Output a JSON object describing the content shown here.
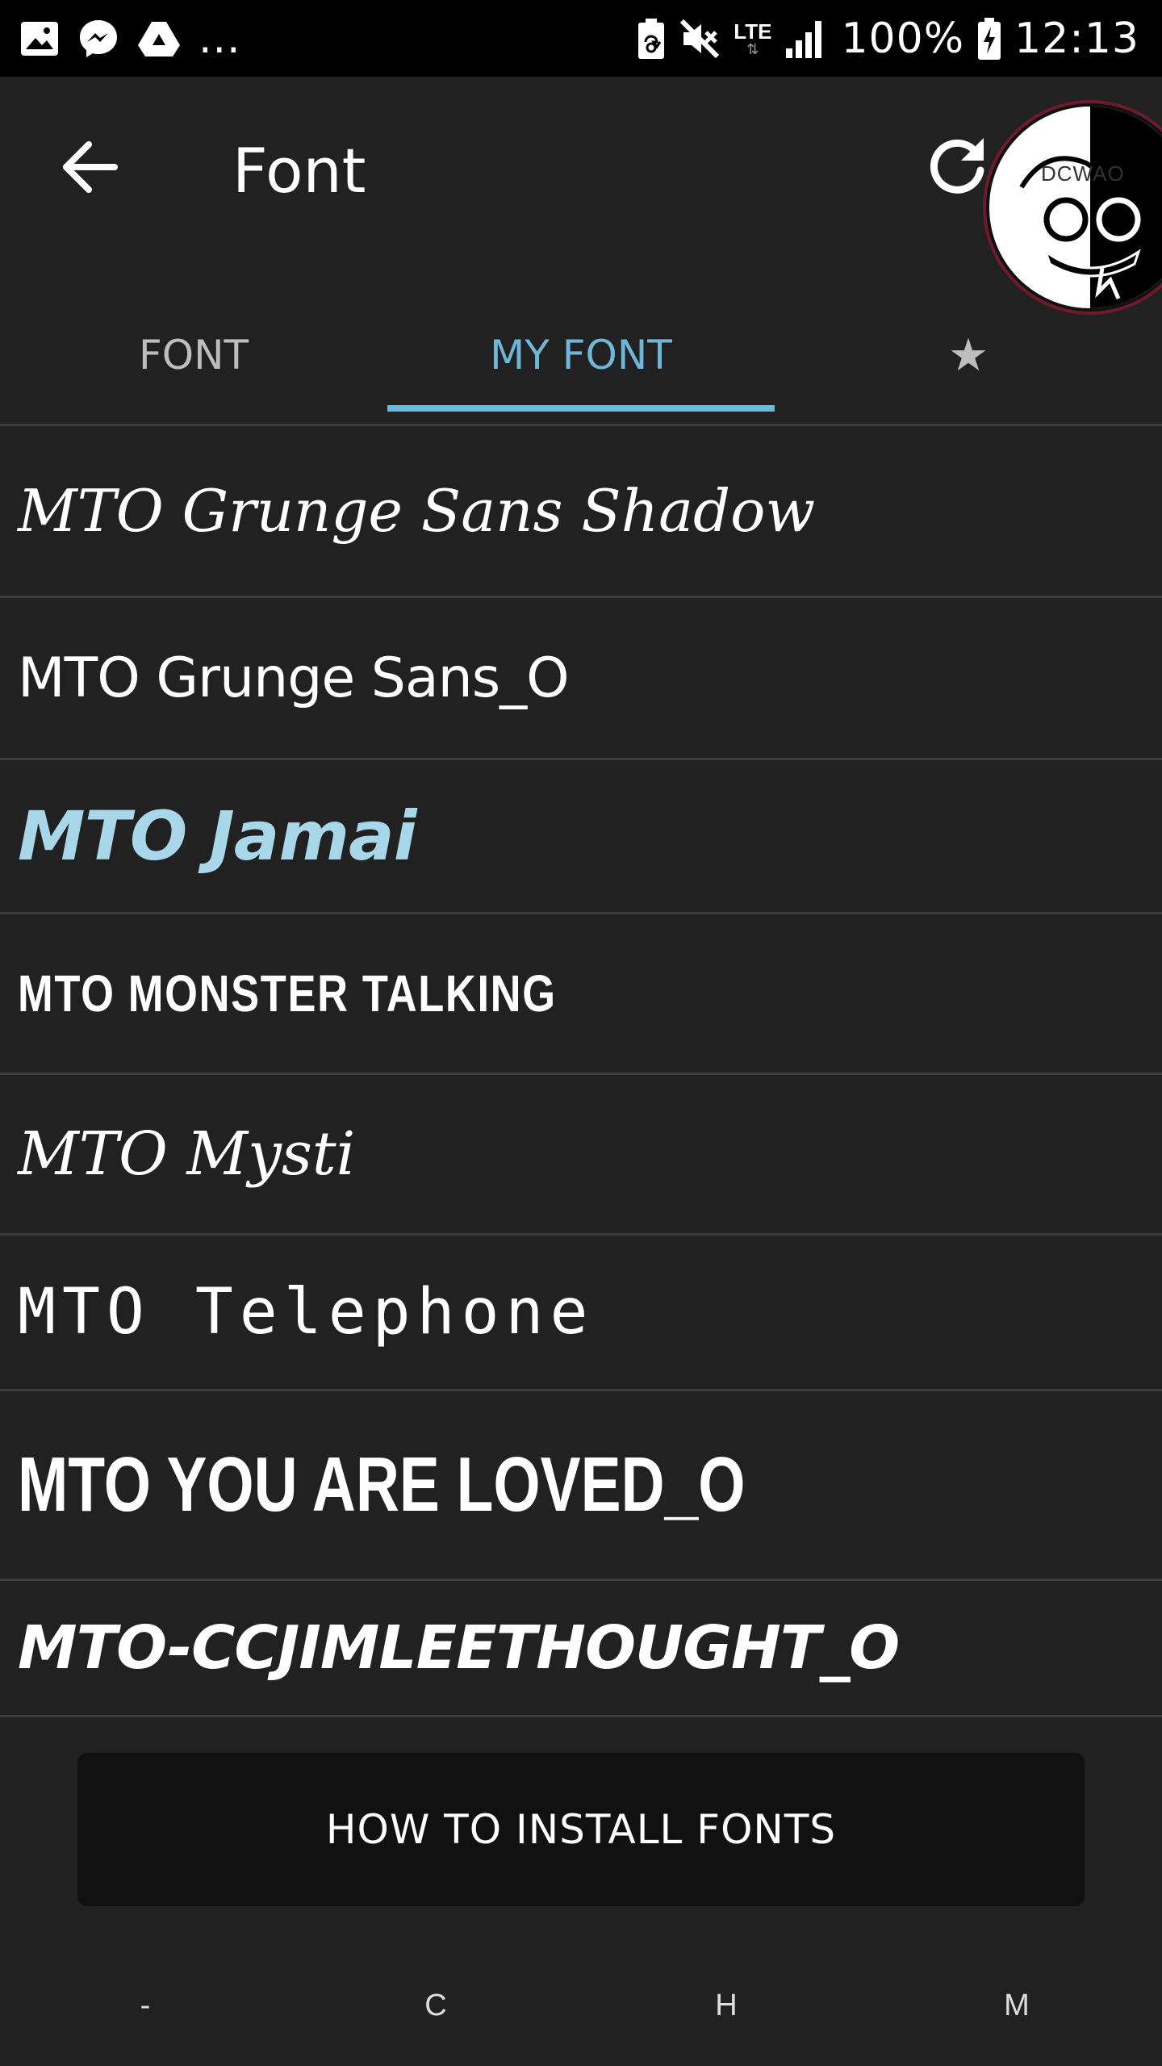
{
  "status_bar": {
    "left_icons": [
      "gallery-icon",
      "messenger-icon",
      "drive-icon"
    ],
    "overflow": "...",
    "network": "LTE",
    "battery": "100%",
    "time": "12:13"
  },
  "toolbar": {
    "title": "Font",
    "avatar_text": "DCWAO"
  },
  "tabs": [
    {
      "label": "FONT",
      "selected": false
    },
    {
      "label": "MY FONT",
      "selected": true
    },
    {
      "label": "★",
      "selected": false
    }
  ],
  "fonts": [
    "MTO Grunge Sans Shadow",
    "MTO Grunge Sans_O",
    "MTO Jamai",
    "MTO MONSTER TALKING",
    "MTO Mysti",
    "MTO Telephone",
    "MTO YOU ARE LOVED_O",
    "MTO-CCJIMLEETHOUGHT_O"
  ],
  "install_button": "HOW TO INSTALL FONTS",
  "bottom_index": [
    "-",
    "C",
    "H",
    "M"
  ],
  "colors": {
    "background": "#212121",
    "accent": "#6fb7d8",
    "highlight_font": "#a9d7ea",
    "divider": "#3b3b3b"
  }
}
